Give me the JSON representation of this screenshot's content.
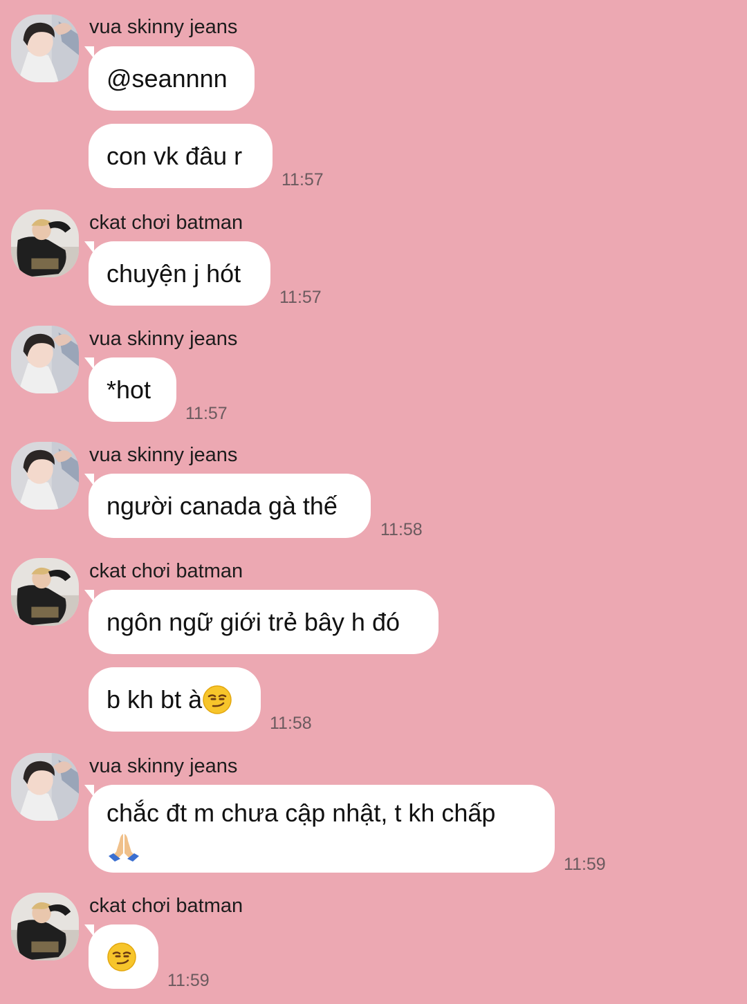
{
  "users": {
    "a": {
      "name": "vua skinny jeans"
    },
    "b": {
      "name": "ckat chơi batman"
    }
  },
  "messages": [
    {
      "sender": "vua skinny jeans",
      "text": "@seannnn",
      "time": ""
    },
    {
      "sender": "",
      "text": "con vk đâu r",
      "time": "11:57"
    },
    {
      "sender": "ckat chơi batman",
      "text": "chuyện j hót",
      "time": "11:57"
    },
    {
      "sender": "vua skinny jeans",
      "text": "*hot",
      "time": "11:57"
    },
    {
      "sender": "vua skinny jeans",
      "text": "người canada gà thế",
      "time": "11:58"
    },
    {
      "sender": "ckat chơi batman",
      "text": "ngôn ngữ giới trẻ bây h đó",
      "time": ""
    },
    {
      "sender": "",
      "text": "b kh bt à",
      "time": "11:58",
      "emoji": "smirking-face"
    },
    {
      "sender": "vua skinny jeans",
      "text": "chắc đt m chưa cập nhật, t kh chấp",
      "time": "11:59",
      "emoji": "folded-hands"
    },
    {
      "sender": "ckat chơi batman",
      "text": "",
      "time": "11:59",
      "emoji": "smirking-face"
    }
  ],
  "colors": {
    "background": "#eca8b2",
    "bubble": "#ffffff",
    "timestamp": "#6b5a5e"
  }
}
